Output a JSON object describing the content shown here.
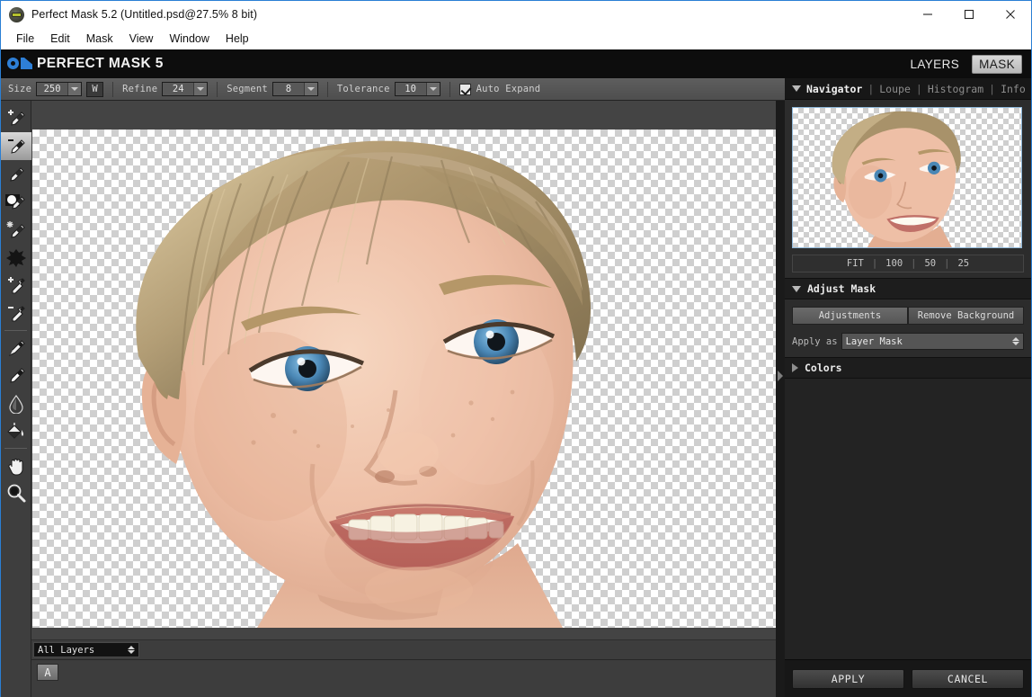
{
  "window": {
    "title": "Perfect Mask 5.2 (Untitled.psd@27.5% 8 bit)",
    "app_icon": "onone-app-icon",
    "minimize": "—",
    "maximize": "□",
    "close": "✕"
  },
  "menu": {
    "items": [
      {
        "label": "File"
      },
      {
        "label": "Edit"
      },
      {
        "label": "Mask"
      },
      {
        "label": "View"
      },
      {
        "label": "Window"
      },
      {
        "label": "Help"
      }
    ]
  },
  "brand": {
    "logo": "on1-logo",
    "name": "PERFECT MASK 5",
    "layers_tab": "LAYERS",
    "mask_tab": "MASK",
    "active_tab": "MASK"
  },
  "options": {
    "size_label": "Size",
    "size_value": "250",
    "width_toggle": "W",
    "refine_label": "Refine",
    "refine_value": "24",
    "segment_label": "Segment",
    "segment_value": "8",
    "tolerance_label": "Tolerance",
    "tolerance_value": "10",
    "auto_expand_label": "Auto Expand",
    "auto_expand_checked": true,
    "remove_background": "Remove Background"
  },
  "tools": [
    {
      "name": "brush-plus-tool",
      "title": "Keep Brush",
      "active": false
    },
    {
      "name": "brush-minus-tool",
      "title": "Drop Brush",
      "active": true
    },
    {
      "name": "brush-tool",
      "title": "Brush",
      "active": false
    },
    {
      "name": "magic-brush-tool",
      "title": "Magic Brush",
      "active": false
    },
    {
      "name": "refine-brush-tool",
      "title": "Refine Brush",
      "active": false
    },
    {
      "name": "blob-tool",
      "title": "Chisel",
      "active": false
    },
    {
      "name": "dropper-plus-tool",
      "title": "Keep Dropper",
      "active": false
    },
    {
      "name": "dropper-minus-tool",
      "title": "Drop Dropper",
      "active": false
    },
    {
      "name": "pen-tool",
      "title": "Pen",
      "active": false
    },
    {
      "name": "paintbrush-tool",
      "title": "Paint Brush",
      "active": false
    },
    {
      "name": "blur-drop-tool",
      "title": "Blur",
      "active": false
    },
    {
      "name": "paint-bucket-tool",
      "title": "Paint Bucket",
      "active": false
    },
    {
      "name": "hand-tool",
      "title": "Hand",
      "active": false
    },
    {
      "name": "zoom-tool",
      "title": "Zoom",
      "active": false
    }
  ],
  "canvas": {
    "layer_select_value": "All Layers",
    "status_button": "A",
    "image_alt": "portrait-of-smiling-woman-on-transparency"
  },
  "navigator": {
    "tabs": [
      {
        "label": "Navigator",
        "active": true
      },
      {
        "label": "Loupe",
        "active": false
      },
      {
        "label": "Histogram",
        "active": false
      },
      {
        "label": "Info",
        "active": false
      }
    ],
    "zoom_levels": [
      "FIT",
      "100",
      "50",
      "25"
    ]
  },
  "adjust_mask": {
    "title": "Adjust Mask",
    "expanded": true,
    "tab_adjustments": "Adjustments",
    "tab_remove_background": "Remove Background",
    "apply_as_label": "Apply as",
    "apply_as_value": "Layer Mask"
  },
  "colors_section": {
    "title": "Colors",
    "expanded": false
  },
  "footer": {
    "apply": "APPLY",
    "cancel": "CANCEL"
  },
  "theme": {
    "accent_blue": "#2e7fd6",
    "panel_dark": "#232323",
    "canvas_gray": "#444444",
    "toolbar_gray": "#545454"
  }
}
